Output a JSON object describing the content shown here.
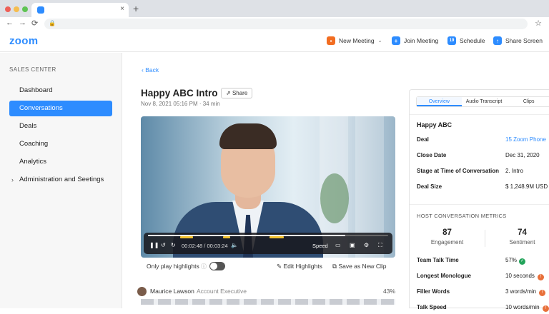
{
  "browser": {
    "tab_title": "",
    "new_tab": "+",
    "close": "×",
    "back": "←",
    "forward": "→",
    "reload": "⟳",
    "lock": "🔒",
    "star": "☆"
  },
  "app": {
    "logo": "zoom"
  },
  "actions": {
    "new_meeting": "New Meeting",
    "join_meeting": "Join Meeting",
    "schedule": "Schedule",
    "share_screen": "Share Screen",
    "schedule_icon": "19"
  },
  "sidebar": {
    "heading": "SALES CENTER",
    "items": [
      {
        "label": "Dashboard"
      },
      {
        "label": "Conversations"
      },
      {
        "label": "Deals"
      },
      {
        "label": "Coaching"
      },
      {
        "label": "Analytics"
      },
      {
        "label": "Administration and Seetings"
      }
    ]
  },
  "main": {
    "back": "Back",
    "title": "Happy ABC Intro",
    "share": "Share",
    "date": "Nov 8, 2021 05:16 PM · 34 min",
    "player": {
      "time": "00:02:48 / 00:03:24",
      "speed": "Speed",
      "progress": 0.82
    },
    "only_highlights": "Only play highlights",
    "edit_highlights": "Edit Highlights",
    "save_clip": "Save as New Clip",
    "speaker": {
      "name": "Maurice Lawson",
      "role": "Account Executive",
      "percent": "43%"
    }
  },
  "panel": {
    "tabs": [
      "Overview",
      "Audio Transcript",
      "Clips"
    ],
    "title": "Happy ABC",
    "details": [
      {
        "k": "Deal",
        "v": "15 Zoom Phone"
      },
      {
        "k": "Close Date",
        "v": "Dec 31, 2020"
      },
      {
        "k": "Stage at Time of Conversation",
        "v": "2. Intro"
      },
      {
        "k": "Deal Size",
        "v": "$ 1,248.9M USD"
      }
    ],
    "metrics_heading": "HOST CONVERSATION METRICS",
    "engagement": {
      "n": "87",
      "t": "Engagement"
    },
    "sentiment": {
      "n": "74",
      "t": "Sentiment"
    },
    "rows": [
      {
        "k": "Team Talk Time",
        "v": "57%"
      },
      {
        "k": "Longest Monologue",
        "v": "10 seconds"
      },
      {
        "k": "Filler Words",
        "v": "3 words/min"
      },
      {
        "k": "Talk Speed",
        "v": "10 words/min"
      }
    ]
  },
  "colors": {
    "accent": "#2d8cff",
    "new_meeting": "#f26d21",
    "good": "#23a45b",
    "warn": "#e8703a"
  }
}
